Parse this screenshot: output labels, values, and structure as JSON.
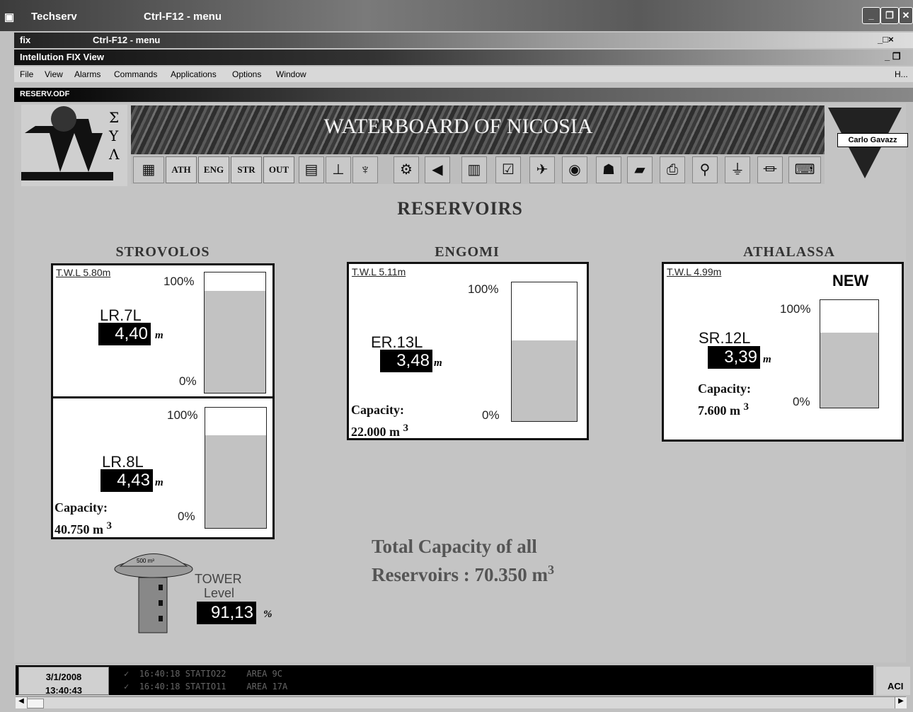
{
  "window": {
    "title": "Techserv",
    "shortcut": "Ctrl-F12 - menu"
  },
  "subwindow": {
    "title": "fix",
    "shortcut": "Ctrl-F12 - menu"
  },
  "app": {
    "title": "Intellution FIX View"
  },
  "menu": [
    "File",
    "View",
    "Alarms",
    "Commands",
    "Applications",
    "Options",
    "Window",
    "H..."
  ],
  "document": {
    "name": "RESERV.ODF"
  },
  "header": {
    "title": "WATERBOARD OF NICOSIA",
    "logo_letters": [
      "Σ",
      "Υ",
      "Λ"
    ],
    "brand": "Carlo Gavazz"
  },
  "toolbar": {
    "buttons": [
      "ATH",
      "ENG",
      "STR",
      "OUT"
    ]
  },
  "page": {
    "title": "RESERVOIRS"
  },
  "strovolos": {
    "name": "STROVOLOS",
    "twl": "T.W.L 5.80m",
    "tank1": {
      "label": "LR.7L",
      "value": "4,40",
      "unit": "m",
      "max": "100%",
      "min": "0%",
      "level": 0.85
    },
    "tank2": {
      "label": "LR.8L",
      "value": "4,43",
      "unit": "m",
      "max": "100%",
      "min": "0%",
      "level": 0.77
    },
    "capacity_label": "Capacity:",
    "capacity_value": "40.750 m",
    "capacity_exp": "3"
  },
  "engomi": {
    "name": "ENGOMI",
    "twl": "T.W.L 5.11m",
    "label": "ER.13L",
    "value": "3,48",
    "unit": "m",
    "max": "100%",
    "min": "0%",
    "level": 0.58,
    "capacity_label": "Capacity:",
    "capacity_value": "22.000 m",
    "capacity_exp": "3"
  },
  "athalassa": {
    "name": "ATHALASSA",
    "twl": "T.W.L 4.99m",
    "badge": "NEW",
    "label": "SR.12L",
    "value": "3,39",
    "unit": "m",
    "max": "100%",
    "min": "0%",
    "level": 0.7,
    "capacity_label": "Capacity:",
    "capacity_value": "7.600 m",
    "capacity_exp": "3"
  },
  "tower": {
    "capacity": "500 m³",
    "label_1": "TOWER",
    "label_2": "Level",
    "value": "91,13",
    "unit": "%"
  },
  "total": {
    "line1": "Total Capacity of all",
    "line2": "Reservoirs : 70.350 m",
    "exp": "3"
  },
  "status": {
    "date": "3/1/2008",
    "time": "13:40:43",
    "alarms": [
      {
        "time": "16:40:18",
        "station": "STATIO22",
        "area": "AREA 9C"
      },
      {
        "time": "16:40:18",
        "station": "STATIO11",
        "area": "AREA 17A"
      }
    ],
    "right": "ACI"
  }
}
